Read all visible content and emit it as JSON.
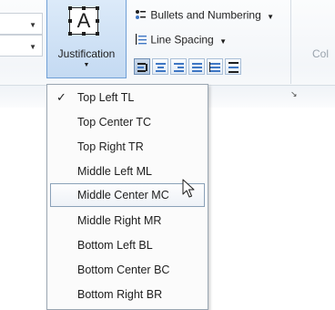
{
  "ribbon": {
    "justification": {
      "label": "Justification",
      "icon_letter": "A"
    },
    "bullets": {
      "label": "Bullets and Numbering"
    },
    "line_spacing": {
      "label": "Line Spacing"
    },
    "partial_right_label": "Col",
    "align_buttons": [
      "align-left-icon",
      "align-center-icon",
      "align-right-icon",
      "justify-icon",
      "distribute-icon",
      "vertical-distribute-icon"
    ]
  },
  "menu": {
    "items": [
      {
        "label": "Top Left TL",
        "checked": true
      },
      {
        "label": "Top Center TC"
      },
      {
        "label": "Top Right TR"
      },
      {
        "label": "Middle Left ML"
      },
      {
        "label": "Middle Center MC",
        "hovered": true
      },
      {
        "label": "Middle Right MR"
      },
      {
        "label": "Bottom Left BL"
      },
      {
        "label": "Bottom Center BC"
      },
      {
        "label": "Bottom Right BR"
      }
    ],
    "check_glyph": "✓"
  },
  "colors": {
    "accent": "#3f77c4",
    "selected_border": "#6f9fd6"
  }
}
